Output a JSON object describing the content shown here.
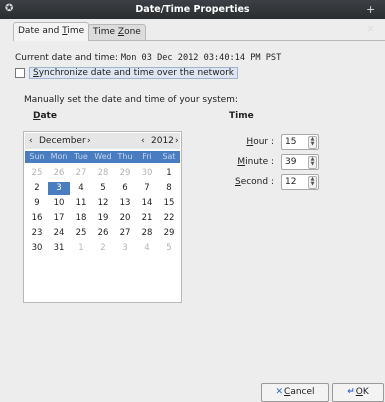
{
  "window": {
    "title": "Date/Time Properties",
    "icon": "gear-icon",
    "close_glyph": "+ ×"
  },
  "tabs": [
    {
      "label": "Date and Time",
      "active": true
    },
    {
      "label": "Time Zone",
      "active": false
    }
  ],
  "current": {
    "label": "Current date and time:",
    "value": "Mon 03 Dec 2012 03:40:14 PM PST"
  },
  "sync": {
    "label": "Synchronize date and time over the network",
    "checked": false
  },
  "manual_label": "Manually set the date and time of your system:",
  "date": {
    "header": "Date",
    "month": "December",
    "year": "2012",
    "prev": "‹",
    "next": "›",
    "weekdays": [
      "Sun",
      "Mon",
      "Tue",
      "Wed",
      "Thu",
      "Fri",
      "Sat"
    ],
    "weeks": [
      [
        "25",
        "26",
        "27",
        "28",
        "29",
        "30",
        "1"
      ],
      [
        "2",
        "3",
        "4",
        "5",
        "6",
        "7",
        "8"
      ],
      [
        "9",
        "10",
        "11",
        "12",
        "13",
        "14",
        "15"
      ],
      [
        "16",
        "17",
        "18",
        "19",
        "20",
        "21",
        "22"
      ],
      [
        "23",
        "24",
        "25",
        "26",
        "27",
        "28",
        "29"
      ],
      [
        "30",
        "31",
        "1",
        "2",
        "3",
        "4",
        "5"
      ]
    ],
    "selected": "3"
  },
  "time": {
    "header": "Time",
    "hour": {
      "label": "Hour :",
      "value": "15"
    },
    "minute": {
      "label": "Minute :",
      "value": "39"
    },
    "second": {
      "label": "Second :",
      "value": "12"
    }
  },
  "buttons": {
    "cancel": "Cancel",
    "ok": "OK"
  },
  "colors": {
    "titlebar": "#2f3236",
    "selection": "#4a7cc0",
    "background": "#ededed"
  }
}
